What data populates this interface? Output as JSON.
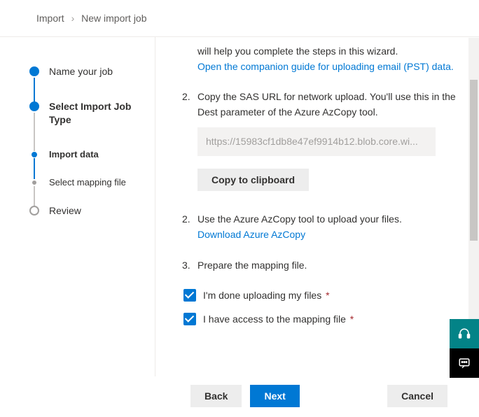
{
  "breadcrumb": {
    "root": "Import",
    "current": "New import job"
  },
  "steps": [
    {
      "label": "Name your job"
    },
    {
      "label": "Select Import Job Type"
    },
    {
      "label": "Import data"
    },
    {
      "label": "Select mapping file"
    },
    {
      "label": "Review"
    }
  ],
  "instructions": {
    "step1_partial": "will help you complete the steps in this wizard.",
    "step1_link": "Open the companion guide for uploading email (PST) data.",
    "step2": "Copy the SAS URL for network upload. You'll use this in the Dest parameter of the Azure AzCopy tool.",
    "sas_url": "https://15983cf1db8e47ef9914b12.blob.core.wi...",
    "copy_btn": "Copy to clipboard",
    "step3": "Use the Azure AzCopy tool to upload your files.",
    "step3_link": "Download Azure AzCopy",
    "step4": "Prepare the mapping file."
  },
  "checkboxes": {
    "done_uploading": "I'm done uploading my files",
    "have_mapping": "I have access to the mapping file"
  },
  "footer": {
    "back": "Back",
    "next": "Next",
    "cancel": "Cancel"
  }
}
